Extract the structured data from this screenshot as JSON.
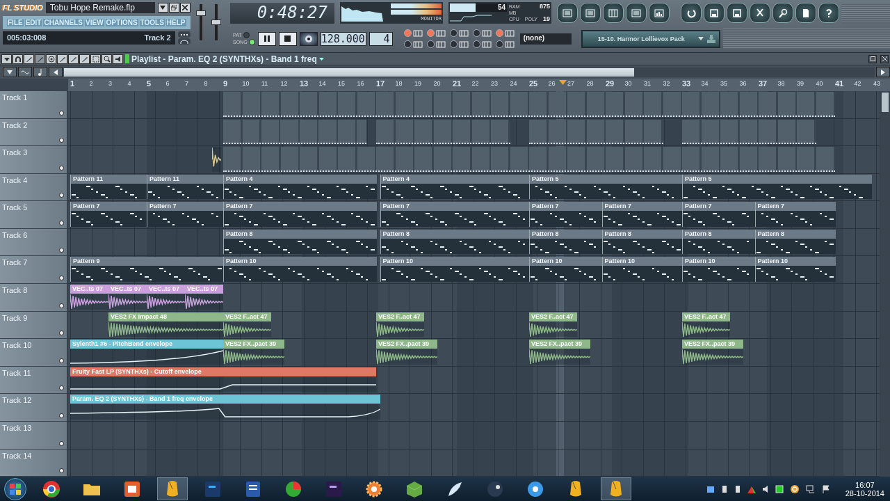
{
  "app": {
    "logo": "FL STUDIO",
    "project_title": "Tobu Hope Remake.flp"
  },
  "menu": [
    "FILE",
    "EDIT",
    "CHANNELS",
    "VIEW",
    "OPTIONS",
    "TOOLS",
    "HELP"
  ],
  "hint_bar": {
    "time": "005:03:008",
    "target": "Track 2"
  },
  "master_sliders": [
    {
      "level": 0.8
    },
    {
      "level": 0.5
    }
  ],
  "transport": {
    "time": "0:48:27",
    "tempo": "128.000",
    "pattern": "4",
    "mode": [
      {
        "label": "PAT",
        "selected": false
      },
      {
        "label": "SONG",
        "selected": true
      }
    ]
  },
  "monitor": {
    "label": "MONITOR"
  },
  "cpu": {
    "value": "54",
    "ram": "875",
    "ram_label": "RAM",
    "mb_label": "MB",
    "cpu_label": "CPU",
    "poly_label": "POLY",
    "poly": "19"
  },
  "toggles": [
    {
      "on": true
    },
    {
      "on": false
    },
    {
      "on": true
    },
    {
      "on": false
    },
    {
      "on": false
    },
    {
      "on": false
    },
    {
      "on": false
    },
    {
      "on": false
    },
    {
      "on": true
    },
    {
      "on": false
    }
  ],
  "snap": {
    "value": "(none)"
  },
  "browser": {
    "preset": "15-10. Harmor Lollievox Pack"
  },
  "playlist": {
    "title": "Playlist - Param. EQ 2 (SYNTHXs) - Band 1 freq",
    "ruler": [
      "1",
      "2",
      "3",
      "4",
      "5",
      "6",
      "7",
      "8",
      "9",
      "10",
      "11",
      "12",
      "13",
      "14",
      "15",
      "16",
      "17",
      "18",
      "19",
      "20",
      "21",
      "22",
      "23",
      "24",
      "25",
      "26",
      "27",
      "28",
      "29",
      "30",
      "31",
      "32",
      "33",
      "34",
      "35",
      "36",
      "37",
      "38",
      "39",
      "40",
      "41",
      "42",
      "43"
    ],
    "tracks": [
      {
        "name": "Track 1",
        "clips": [
          {
            "kind": "strip"
          }
        ]
      },
      {
        "name": "Track 2",
        "clips": [
          {
            "kind": "strip"
          },
          {
            "kind": "strip"
          },
          {
            "kind": "strip"
          },
          {
            "kind": "strip"
          }
        ]
      },
      {
        "name": "Track 3",
        "clips": [
          {
            "kind": "audio",
            "color": "#d8c890"
          },
          {
            "kind": "strip"
          }
        ]
      },
      {
        "name": "Track 4",
        "clips": [
          {
            "kind": "pattern",
            "label": "Pattern 11"
          },
          {
            "kind": "pattern",
            "label": "Pattern 11"
          },
          {
            "kind": "pattern",
            "label": "Pattern 4"
          },
          {
            "kind": "pattern",
            "label": "Pattern 4"
          },
          {
            "kind": "pattern",
            "label": "Pattern 5"
          },
          {
            "kind": "pattern",
            "label": "Pattern 5"
          }
        ]
      },
      {
        "name": "Track 5",
        "clips": [
          {
            "kind": "pattern",
            "label": "Pattern 7"
          },
          {
            "kind": "pattern",
            "label": "Pattern 7"
          },
          {
            "kind": "pattern",
            "label": "Pattern 7"
          },
          {
            "kind": "pattern",
            "label": "Pattern 7"
          },
          {
            "kind": "pattern",
            "label": "Pattern 7"
          },
          {
            "kind": "pattern",
            "label": "Pattern 7"
          },
          {
            "kind": "pattern",
            "label": "Pattern 7"
          },
          {
            "kind": "pattern",
            "label": "Pattern 7"
          }
        ]
      },
      {
        "name": "Track 6",
        "clips": [
          {
            "kind": "pattern",
            "label": "Pattern 8"
          },
          {
            "kind": "pattern",
            "label": "Pattern 8"
          },
          {
            "kind": "pattern",
            "label": "Pattern 8"
          },
          {
            "kind": "pattern",
            "label": "Pattern 8"
          },
          {
            "kind": "pattern",
            "label": "Pattern 8"
          },
          {
            "kind": "pattern",
            "label": "Pattern 8"
          }
        ]
      },
      {
        "name": "Track 7",
        "clips": [
          {
            "kind": "pattern",
            "label": "Pattern 9"
          },
          {
            "kind": "pattern",
            "label": "Pattern 10"
          },
          {
            "kind": "pattern",
            "label": "Pattern 10"
          },
          {
            "kind": "pattern",
            "label": "Pattern 10"
          },
          {
            "kind": "pattern",
            "label": "Pattern 10"
          },
          {
            "kind": "pattern",
            "label": "Pattern 10"
          },
          {
            "kind": "pattern",
            "label": "Pattern 10"
          }
        ]
      },
      {
        "name": "Track 8",
        "clips": [
          {
            "kind": "audio",
            "label": "VEC..ts 07",
            "color": "#c8a0dc"
          },
          {
            "kind": "audio",
            "label": "VEC..ts 07",
            "color": "#c8a0dc"
          },
          {
            "kind": "audio",
            "label": "VEC..ts 07",
            "color": "#c8a0dc"
          },
          {
            "kind": "audio",
            "label": "VEC..ts 07",
            "color": "#c8a0dc"
          }
        ]
      },
      {
        "name": "Track 9",
        "clips": [
          {
            "kind": "audio",
            "label": "VES2 FX Impact 48",
            "color": "#8fb88a"
          },
          {
            "kind": "audio",
            "label": "VES2 F..act 47",
            "color": "#8fb88a"
          },
          {
            "kind": "audio",
            "label": "VES2 F..act 47",
            "color": "#8fb88a"
          },
          {
            "kind": "audio",
            "label": "VES2 F..act 47",
            "color": "#8fb88a"
          },
          {
            "kind": "audio",
            "label": "VES2 F..act 47",
            "color": "#8fb88a"
          }
        ]
      },
      {
        "name": "Track 10",
        "clips": [
          {
            "kind": "automation",
            "label": "Sylenth1 #6 - PitchBend envelope",
            "color": "#6cc4d4"
          },
          {
            "kind": "audio",
            "label": "VES2 FX..pact 39",
            "color": "#8fb88a"
          },
          {
            "kind": "audio",
            "label": "VES2 FX..pact 39",
            "color": "#8fb88a"
          },
          {
            "kind": "audio",
            "label": "VES2 FX..pact 39",
            "color": "#8fb88a"
          },
          {
            "kind": "audio",
            "label": "VES2 FX..pact 39",
            "color": "#8fb88a"
          }
        ]
      },
      {
        "name": "Track 11",
        "clips": [
          {
            "kind": "automation",
            "label": "Fruity Fast LP (SYNTHXs) - Cutoff envelope",
            "color": "#e07868"
          }
        ]
      },
      {
        "name": "Track 12",
        "clips": [
          {
            "kind": "automation",
            "label": "Param. EQ 2 (SYNTHXs) - Band 1 freq envelope",
            "color": "#6cc4d4"
          }
        ]
      },
      {
        "name": "Track 13"
      },
      {
        "name": "Track 14"
      }
    ]
  },
  "taskbar": {
    "time": "16:07",
    "date": "28-10-2014"
  }
}
